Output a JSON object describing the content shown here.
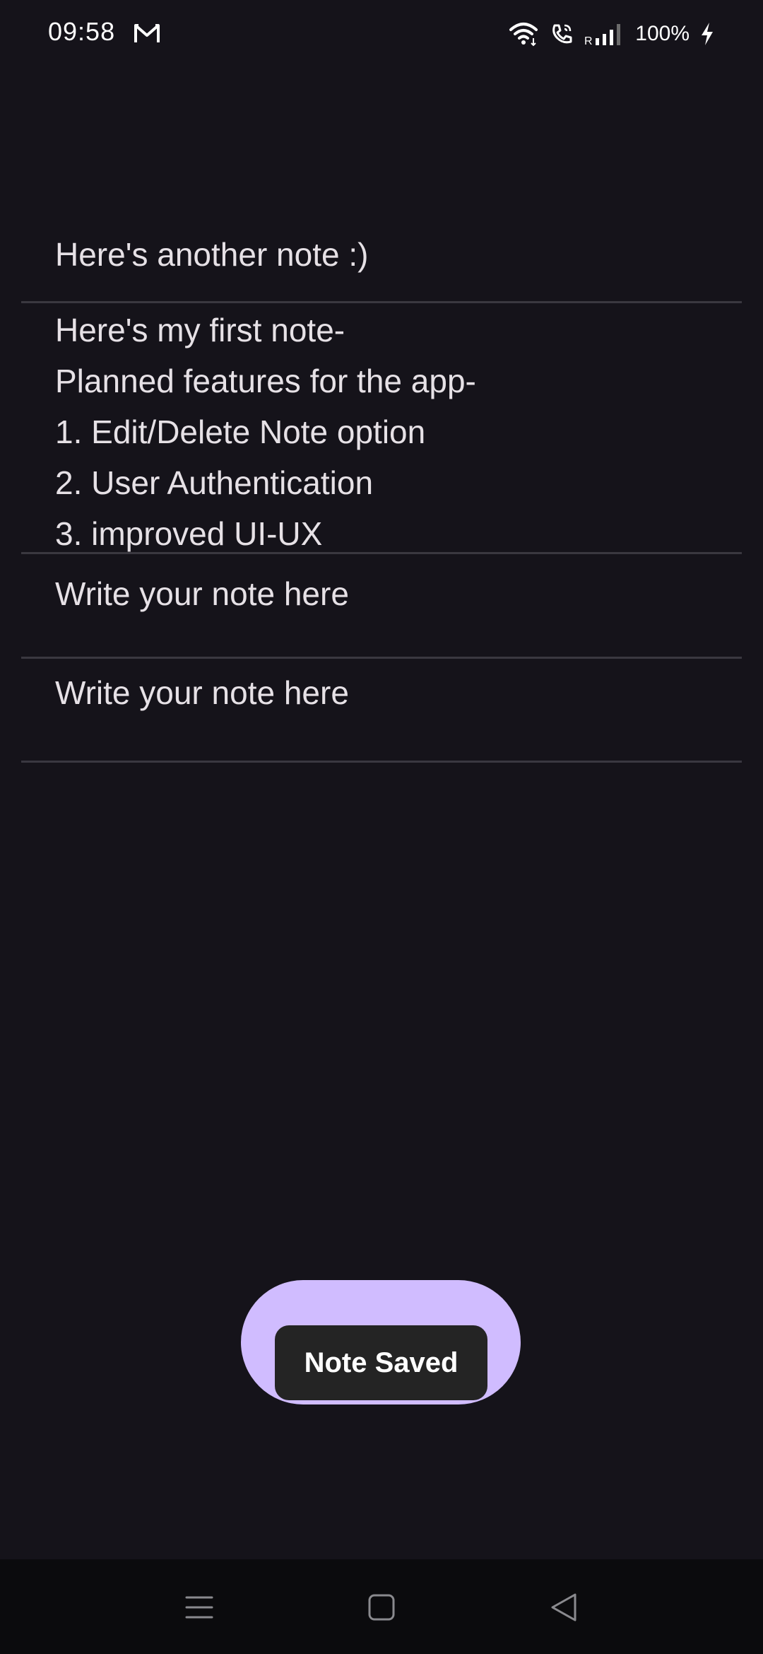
{
  "status_bar": {
    "time": "09:58",
    "battery": "100%",
    "icons": [
      "gmail-icon",
      "wifi-icon",
      "wifi-calling-icon",
      "signal-icon",
      "charging-icon"
    ],
    "roaming_label": "R"
  },
  "notes": [
    {
      "text": "Here's another note :)"
    },
    {
      "text": "Here's my first note-\nPlanned features for the app-\n1. Edit/Delete Note option\n2. User Authentication\n3. improved UI-UX"
    },
    {
      "text": "Write your note here"
    },
    {
      "text": "Write your note here"
    }
  ],
  "toast": {
    "message": "Note Saved"
  },
  "colors": {
    "background": "#15131a",
    "fab": "#d0bcff",
    "toast": "#242424",
    "divider": "#3a3840"
  },
  "nav_bar": {
    "icons": [
      "menu-icon",
      "home-icon",
      "back-icon"
    ]
  }
}
